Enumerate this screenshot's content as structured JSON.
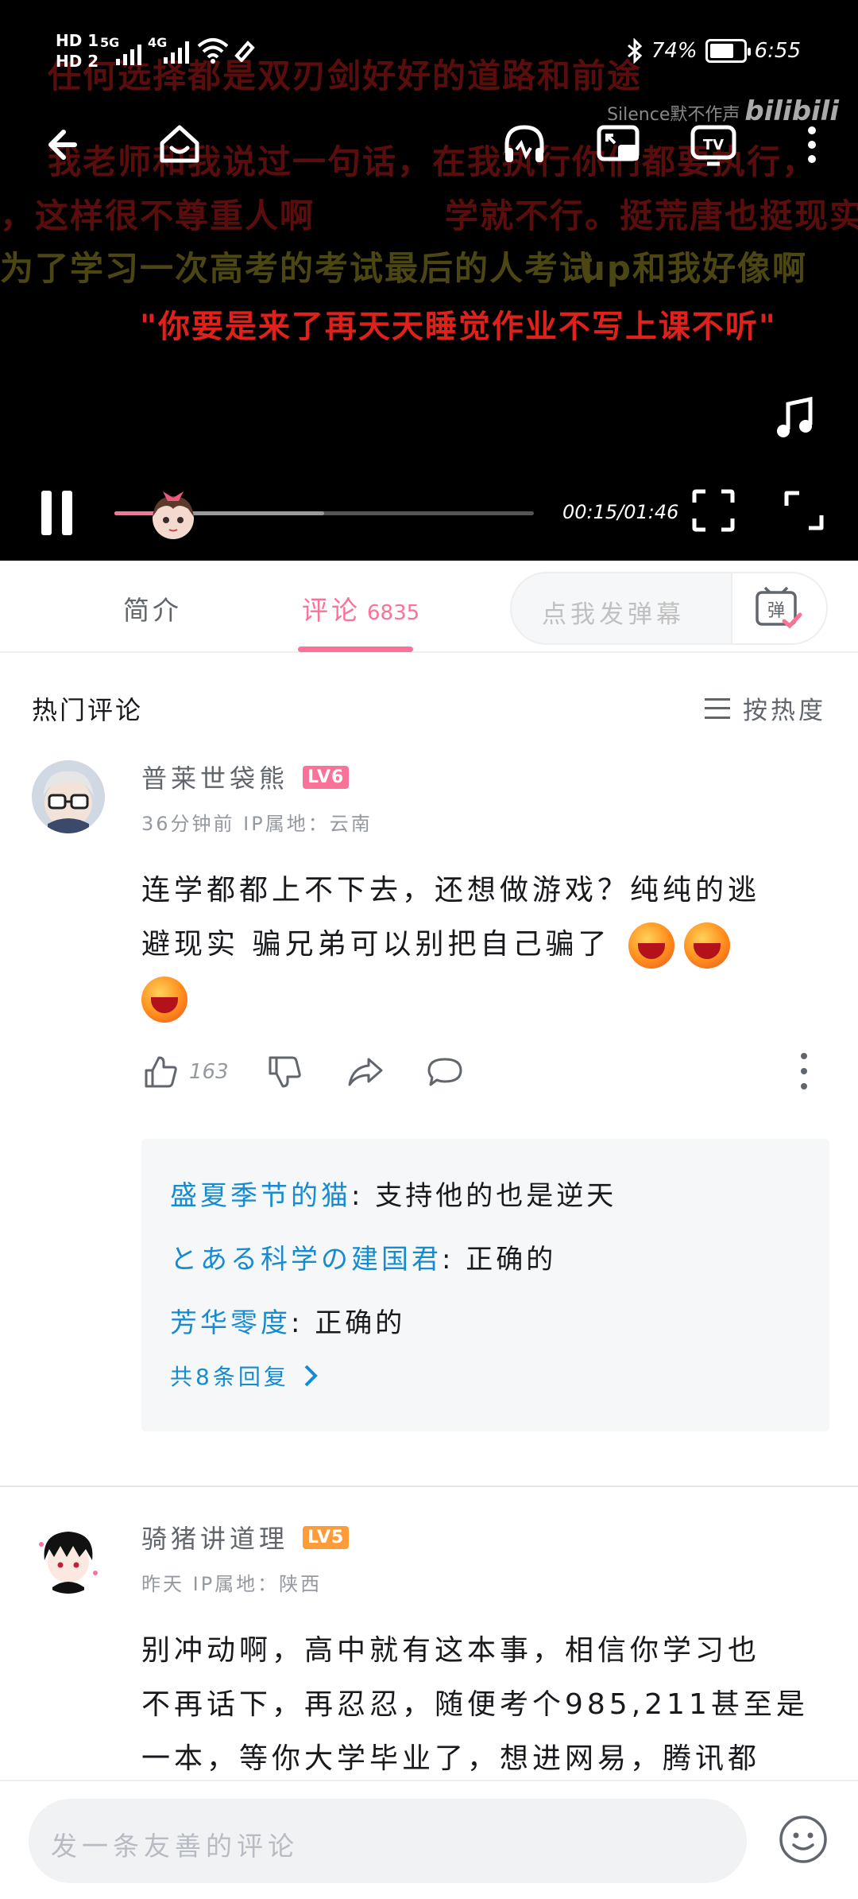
{
  "status_bar": {
    "left_labels": [
      "HD 1",
      "HD 2"
    ],
    "net_1": "5G",
    "net_2": "4G",
    "battery": "74%",
    "time": "6:55",
    "battery_level": 0.74
  },
  "player": {
    "danmaku": [
      "任何选择都是双刃剑好好的道路和前途",
      "我老师和我说过一句话，在我执行你们都要执行，",
      "，这样很不尊重人啊",
      "学就不行。挺荒唐也挺现实",
      "为了学习一次高考的考试最后的人考试",
      "up和我好像啊",
      "\"你要是来了再天天睡觉作业不写上课不听\""
    ],
    "watermark_user": "Silence默不作声",
    "watermark_brand": "bilibili",
    "time_display": "00:15/01:46",
    "played_fraction": 0.141,
    "buffered_fraction": 0.5
  },
  "tabs": {
    "intro": "简介",
    "comments": "评论",
    "comments_count": "6835",
    "danmaku_placeholder": "点我发弹幕",
    "danmaku_button": "弹"
  },
  "comments_header": {
    "title": "热门评论",
    "sort_label": "按热度"
  },
  "comments": [
    {
      "user": "普莱世袋熊",
      "level": "LV6",
      "meta": "36分钟前 IP属地：云南",
      "text_1": "连学都都上不下去，还想做游戏？纯纯的逃",
      "text_2": "避现实 骗兄弟可以别把自己骗了",
      "likes": "163",
      "replies": [
        {
          "name": "盛夏季节的猫",
          "text": ": 支持他的也是逆天"
        },
        {
          "name": "とある科学の建国君",
          "text": ": 正确的"
        },
        {
          "name": "芳华零度",
          "text": ": 正确的"
        }
      ],
      "more_replies": "共8条回复"
    },
    {
      "user": "骑猪讲道理",
      "level": "LV5",
      "meta": "昨天 IP属地：陕西",
      "lines": [
        "别冲动啊，高中就有这本事，相信你学习也",
        "不再话下，再忍忍，随便考个985,211甚至是",
        "一本，等你大学毕业了，想进网易，腾讯都"
      ]
    }
  ],
  "bottom_bar": {
    "placeholder": "发一条友善的评论"
  },
  "colors": {
    "accent_pink": "#fb7299",
    "reply_blue": "#178bcf",
    "danmaku_red": "#e0201a"
  },
  "icons": [
    "back-arrow-icon",
    "home-icon",
    "headphones-icon",
    "pip-icon",
    "cast-tv-icon",
    "more-vertical-icon",
    "music-note-icon",
    "pause-icon",
    "fullscreen-icon",
    "expand-icon",
    "danmaku-icon",
    "sort-lines-icon",
    "thumb-up-icon",
    "thumb-down-icon",
    "share-icon",
    "comment-bubble-icon",
    "chevron-right-icon",
    "smiley-icon"
  ]
}
